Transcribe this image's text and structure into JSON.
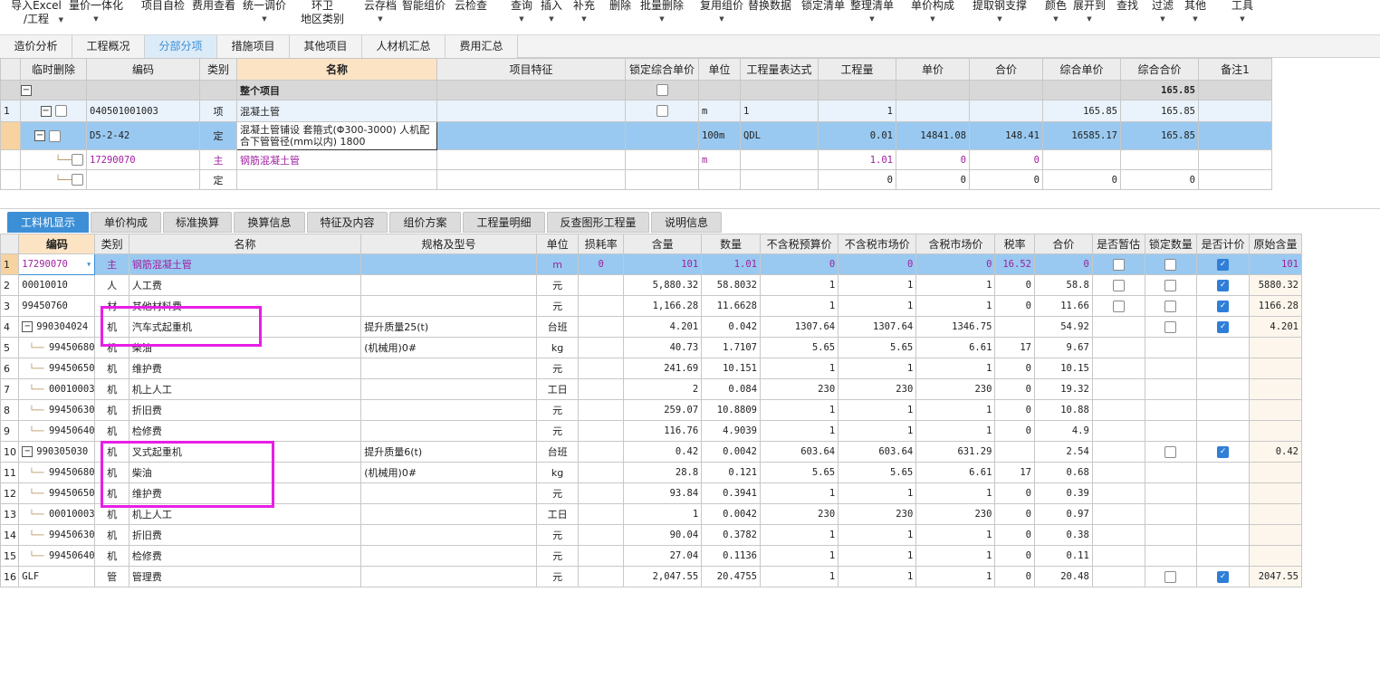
{
  "toolbar": [
    {
      "label": "导入Excel\n/工程",
      "caret": true
    },
    {
      "label": "量价一体化",
      "caret": true
    },
    {
      "label": "项目自检",
      "caret": false
    },
    {
      "label": "费用查看",
      "caret": false
    },
    {
      "label": "统一调价",
      "caret": true
    },
    {
      "label": "环卫\n地区类别",
      "caret": false
    },
    {
      "label": "云存档",
      "caret": true
    },
    {
      "label": "智能组价",
      "caret": false
    },
    {
      "label": "云检查",
      "caret": false
    },
    {
      "label": "查询",
      "caret": true
    },
    {
      "label": "插入",
      "caret": true
    },
    {
      "label": "补充",
      "caret": true
    },
    {
      "label": "删除",
      "caret": false
    },
    {
      "label": "批量删除",
      "caret": true
    },
    {
      "label": "复用组价",
      "caret": true
    },
    {
      "label": "替换数据",
      "caret": false
    },
    {
      "label": "锁定清单",
      "caret": false
    },
    {
      "label": "整理清单",
      "caret": true
    },
    {
      "label": "单价构成",
      "caret": true
    },
    {
      "label": "提取钢支撑",
      "caret": true
    },
    {
      "label": "颜色",
      "caret": true
    },
    {
      "label": "展开到",
      "caret": true
    },
    {
      "label": "查找",
      "caret": false
    },
    {
      "label": "过滤",
      "caret": true
    },
    {
      "label": "其他",
      "caret": true
    },
    {
      "label": "工具",
      "caret": true
    }
  ],
  "main_tabs": [
    "造价分析",
    "工程概况",
    "分部分项",
    "措施项目",
    "其他项目",
    "人材机汇总",
    "费用汇总"
  ],
  "main_tabs_active": 2,
  "upper": {
    "headers": [
      "",
      "临时删除",
      "编码",
      "类别",
      "名称",
      "项目特征",
      "锁定综合单价",
      "单位",
      "工程量表达式",
      "工程量",
      "单价",
      "合价",
      "综合单价",
      "综合合价",
      "备注1"
    ],
    "rows": [
      {
        "no": "",
        "code": "",
        "type": "",
        "name": "整个项目",
        "feature": "",
        "unit": "",
        "expr": "",
        "qty": "",
        "price": "",
        "total": "",
        "uprice": "",
        "utotal": "165.85",
        "remark": ""
      },
      {
        "no": "1",
        "code": "040501001003",
        "type": "项",
        "name": "混凝土管",
        "feature": "",
        "unit": "m",
        "expr": "1",
        "qty": "1",
        "price": "",
        "total": "",
        "uprice": "165.85",
        "utotal": "165.85",
        "remark": ""
      },
      {
        "no": "",
        "code": "D5-2-42",
        "type": "定",
        "name": "混凝土管铺设 套箍式(Φ300-3000) 人机配合下管管径(mm以内) 1800",
        "feature": "",
        "unit": "100m",
        "expr": "QDL",
        "qty": "0.01",
        "price": "14841.08",
        "total": "148.41",
        "uprice": "16585.17",
        "utotal": "165.85",
        "remark": ""
      },
      {
        "no": "",
        "code": "17290070",
        "type": "主",
        "name": "钢筋混凝土管",
        "feature": "",
        "unit": "m",
        "expr": "",
        "qty": "1.01",
        "price": "0",
        "total": "0",
        "uprice": "",
        "utotal": "",
        "remark": ""
      },
      {
        "no": "",
        "code": "",
        "type": "定",
        "name": "",
        "feature": "",
        "unit": "",
        "expr": "",
        "qty": "0",
        "price": "0",
        "total": "0",
        "uprice": "0",
        "utotal": "0",
        "remark": ""
      }
    ]
  },
  "lower_tabs": [
    "工料机显示",
    "单价构成",
    "标准换算",
    "换算信息",
    "特征及内容",
    "组价方案",
    "工程量明细",
    "反查图形工程量",
    "说明信息"
  ],
  "lower_tabs_active": 0,
  "lower": {
    "headers": [
      "",
      "编码",
      "类别",
      "名称",
      "规格及型号",
      "单位",
      "损耗率",
      "含量",
      "数量",
      "不含税预算价",
      "不含税市场价",
      "含税市场价",
      "税率",
      "合价",
      "是否暂估",
      "锁定数量",
      "是否计价",
      "原始含量"
    ],
    "rows": [
      {
        "no": "1",
        "code": "17290070",
        "type": "主",
        "name": "钢筋混凝土管",
        "spec": "",
        "unit": "m",
        "loss": "0",
        "content": "101",
        "qty": "1.01",
        "p1": "0",
        "p2": "0",
        "p3": "0",
        "tax": "16.52",
        "total": "0",
        "est": false,
        "lock": false,
        "calc": true,
        "orig": "101"
      },
      {
        "no": "2",
        "code": "00010010",
        "type": "人",
        "name": "人工费",
        "spec": "",
        "unit": "元",
        "loss": "",
        "content": "5,880.32",
        "qty": "58.8032",
        "p1": "1",
        "p2": "1",
        "p3": "1",
        "tax": "0",
        "total": "58.8",
        "est": false,
        "lock": false,
        "calc": true,
        "orig": "5880.32"
      },
      {
        "no": "3",
        "code": "99450760",
        "type": "材",
        "name": "其他材料费",
        "spec": "",
        "unit": "元",
        "loss": "",
        "content": "1,166.28",
        "qty": "11.6628",
        "p1": "1",
        "p2": "1",
        "p3": "1",
        "tax": "0",
        "total": "11.66",
        "est": false,
        "lock": false,
        "calc": true,
        "orig": "1166.28"
      },
      {
        "no": "4",
        "code": "990304024",
        "type": "机",
        "name": "汽车式起重机",
        "spec": "提升质量25(t)",
        "unit": "台班",
        "loss": "",
        "content": "4.201",
        "qty": "0.042",
        "p1": "1307.64",
        "p2": "1307.64",
        "p3": "1346.75",
        "tax": "",
        "total": "54.92",
        "est": null,
        "lock": false,
        "calc": true,
        "orig": "4.201"
      },
      {
        "no": "5",
        "code": "99450680",
        "type": "机",
        "name": "柴油",
        "spec": "(机械用)0#",
        "unit": "kg",
        "loss": "",
        "content": "40.73",
        "qty": "1.7107",
        "p1": "5.65",
        "p2": "5.65",
        "p3": "6.61",
        "tax": "17",
        "total": "9.67",
        "est": null,
        "lock": null,
        "calc": null,
        "orig": ""
      },
      {
        "no": "6",
        "code": "99450650",
        "type": "机",
        "name": "维护费",
        "spec": "",
        "unit": "元",
        "loss": "",
        "content": "241.69",
        "qty": "10.151",
        "p1": "1",
        "p2": "1",
        "p3": "1",
        "tax": "0",
        "total": "10.15",
        "est": null,
        "lock": null,
        "calc": null,
        "orig": ""
      },
      {
        "no": "7",
        "code": "00010003",
        "type": "机",
        "name": "机上人工",
        "spec": "",
        "unit": "工日",
        "loss": "",
        "content": "2",
        "qty": "0.084",
        "p1": "230",
        "p2": "230",
        "p3": "230",
        "tax": "0",
        "total": "19.32",
        "est": null,
        "lock": null,
        "calc": null,
        "orig": ""
      },
      {
        "no": "8",
        "code": "99450630",
        "type": "机",
        "name": "折旧费",
        "spec": "",
        "unit": "元",
        "loss": "",
        "content": "259.07",
        "qty": "10.8809",
        "p1": "1",
        "p2": "1",
        "p3": "1",
        "tax": "0",
        "total": "10.88",
        "est": null,
        "lock": null,
        "calc": null,
        "orig": ""
      },
      {
        "no": "9",
        "code": "99450640",
        "type": "机",
        "name": "检修费",
        "spec": "",
        "unit": "元",
        "loss": "",
        "content": "116.76",
        "qty": "4.9039",
        "p1": "1",
        "p2": "1",
        "p3": "1",
        "tax": "0",
        "total": "4.9",
        "est": null,
        "lock": null,
        "calc": null,
        "orig": ""
      },
      {
        "no": "10",
        "code": "990305030",
        "type": "机",
        "name": "叉式起重机",
        "spec": "提升质量6(t)",
        "unit": "台班",
        "loss": "",
        "content": "0.42",
        "qty": "0.0042",
        "p1": "603.64",
        "p2": "603.64",
        "p3": "631.29",
        "tax": "",
        "total": "2.54",
        "est": null,
        "lock": false,
        "calc": true,
        "orig": "0.42"
      },
      {
        "no": "11",
        "code": "99450680",
        "type": "机",
        "name": "柴油",
        "spec": "(机械用)0#",
        "unit": "kg",
        "loss": "",
        "content": "28.8",
        "qty": "0.121",
        "p1": "5.65",
        "p2": "5.65",
        "p3": "6.61",
        "tax": "17",
        "total": "0.68",
        "est": null,
        "lock": null,
        "calc": null,
        "orig": ""
      },
      {
        "no": "12",
        "code": "99450650",
        "type": "机",
        "name": "维护费",
        "spec": "",
        "unit": "元",
        "loss": "",
        "content": "93.84",
        "qty": "0.3941",
        "p1": "1",
        "p2": "1",
        "p3": "1",
        "tax": "0",
        "total": "0.39",
        "est": null,
        "lock": null,
        "calc": null,
        "orig": ""
      },
      {
        "no": "13",
        "code": "00010003",
        "type": "机",
        "name": "机上人工",
        "spec": "",
        "unit": "工日",
        "loss": "",
        "content": "1",
        "qty": "0.0042",
        "p1": "230",
        "p2": "230",
        "p3": "230",
        "tax": "0",
        "total": "0.97",
        "est": null,
        "lock": null,
        "calc": null,
        "orig": ""
      },
      {
        "no": "14",
        "code": "99450630",
        "type": "机",
        "name": "折旧费",
        "spec": "",
        "unit": "元",
        "loss": "",
        "content": "90.04",
        "qty": "0.3782",
        "p1": "1",
        "p2": "1",
        "p3": "1",
        "tax": "0",
        "total": "0.38",
        "est": null,
        "lock": null,
        "calc": null,
        "orig": ""
      },
      {
        "no": "15",
        "code": "99450640",
        "type": "机",
        "name": "检修费",
        "spec": "",
        "unit": "元",
        "loss": "",
        "content": "27.04",
        "qty": "0.1136",
        "p1": "1",
        "p2": "1",
        "p3": "1",
        "tax": "0",
        "total": "0.11",
        "est": null,
        "lock": null,
        "calc": null,
        "orig": ""
      },
      {
        "no": "16",
        "code": "GLF",
        "type": "管",
        "name": "管理费",
        "spec": "",
        "unit": "元",
        "loss": "",
        "content": "2,047.55",
        "qty": "20.4755",
        "p1": "1",
        "p2": "1",
        "p3": "1",
        "tax": "0",
        "total": "20.48",
        "est": null,
        "lock": false,
        "calc": true,
        "orig": "2047.55"
      }
    ]
  },
  "colors": {
    "accent": "#3c8fd6",
    "selected_row": "#99c9f0",
    "highlight_box": "#e81ee6",
    "main_material": "#a020a0"
  }
}
